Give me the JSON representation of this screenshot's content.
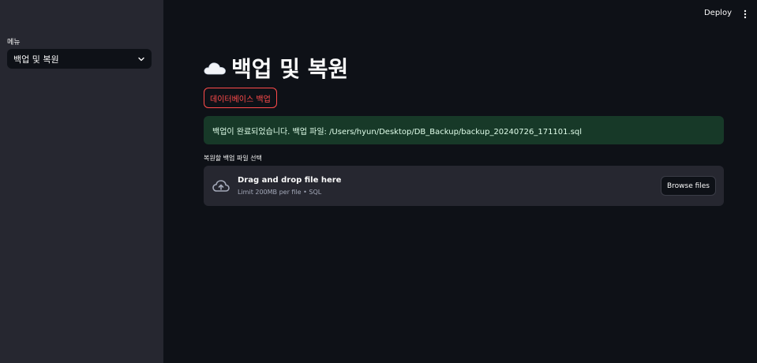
{
  "sidebar": {
    "menu_label": "메뉴",
    "selected_menu": "백업 및 복원"
  },
  "header": {
    "deploy_label": "Deploy"
  },
  "main": {
    "title": "백업 및 복원",
    "backup_button_label": "데이터베이스 백업",
    "success_message": "백업이 완료되었습니다. 백업 파일: /Users/hyun/Desktop/DB_Backup/backup_20240726_171101.sql",
    "uploader": {
      "label": "복원할 백업 파일 선택",
      "drag_text": "Drag and drop file here",
      "limit_text": "Limit 200MB per file • SQL",
      "browse_label": "Browse files"
    }
  },
  "colors": {
    "background": "#0e1117",
    "sidebar": "#262730",
    "accent": "#ff4b4b",
    "success_bg": "#173928"
  }
}
